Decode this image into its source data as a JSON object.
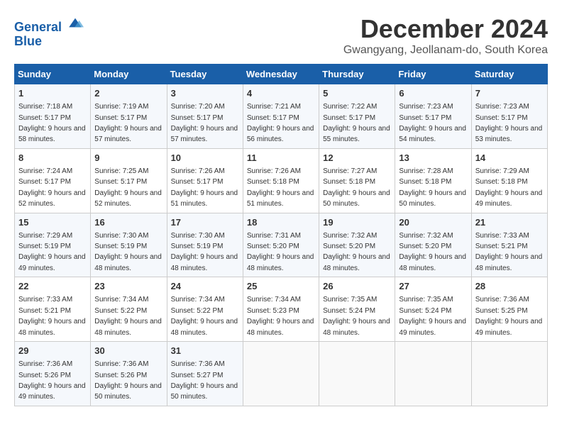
{
  "logo": {
    "line1": "General",
    "line2": "Blue",
    "arrow_color": "#1a5fa8"
  },
  "title": "December 2024",
  "location": "Gwangyang, Jeollanam-do, South Korea",
  "days_of_week": [
    "Sunday",
    "Monday",
    "Tuesday",
    "Wednesday",
    "Thursday",
    "Friday",
    "Saturday"
  ],
  "weeks": [
    [
      {
        "day": 1,
        "sunrise": "7:18 AM",
        "sunset": "5:17 PM",
        "daylight": "9 hours and 58 minutes."
      },
      {
        "day": 2,
        "sunrise": "7:19 AM",
        "sunset": "5:17 PM",
        "daylight": "9 hours and 57 minutes."
      },
      {
        "day": 3,
        "sunrise": "7:20 AM",
        "sunset": "5:17 PM",
        "daylight": "9 hours and 57 minutes."
      },
      {
        "day": 4,
        "sunrise": "7:21 AM",
        "sunset": "5:17 PM",
        "daylight": "9 hours and 56 minutes."
      },
      {
        "day": 5,
        "sunrise": "7:22 AM",
        "sunset": "5:17 PM",
        "daylight": "9 hours and 55 minutes."
      },
      {
        "day": 6,
        "sunrise": "7:23 AM",
        "sunset": "5:17 PM",
        "daylight": "9 hours and 54 minutes."
      },
      {
        "day": 7,
        "sunrise": "7:23 AM",
        "sunset": "5:17 PM",
        "daylight": "9 hours and 53 minutes."
      }
    ],
    [
      {
        "day": 8,
        "sunrise": "7:24 AM",
        "sunset": "5:17 PM",
        "daylight": "9 hours and 52 minutes."
      },
      {
        "day": 9,
        "sunrise": "7:25 AM",
        "sunset": "5:17 PM",
        "daylight": "9 hours and 52 minutes."
      },
      {
        "day": 10,
        "sunrise": "7:26 AM",
        "sunset": "5:17 PM",
        "daylight": "9 hours and 51 minutes."
      },
      {
        "day": 11,
        "sunrise": "7:26 AM",
        "sunset": "5:18 PM",
        "daylight": "9 hours and 51 minutes."
      },
      {
        "day": 12,
        "sunrise": "7:27 AM",
        "sunset": "5:18 PM",
        "daylight": "9 hours and 50 minutes."
      },
      {
        "day": 13,
        "sunrise": "7:28 AM",
        "sunset": "5:18 PM",
        "daylight": "9 hours and 50 minutes."
      },
      {
        "day": 14,
        "sunrise": "7:29 AM",
        "sunset": "5:18 PM",
        "daylight": "9 hours and 49 minutes."
      }
    ],
    [
      {
        "day": 15,
        "sunrise": "7:29 AM",
        "sunset": "5:19 PM",
        "daylight": "9 hours and 49 minutes."
      },
      {
        "day": 16,
        "sunrise": "7:30 AM",
        "sunset": "5:19 PM",
        "daylight": "9 hours and 48 minutes."
      },
      {
        "day": 17,
        "sunrise": "7:30 AM",
        "sunset": "5:19 PM",
        "daylight": "9 hours and 48 minutes."
      },
      {
        "day": 18,
        "sunrise": "7:31 AM",
        "sunset": "5:20 PM",
        "daylight": "9 hours and 48 minutes."
      },
      {
        "day": 19,
        "sunrise": "7:32 AM",
        "sunset": "5:20 PM",
        "daylight": "9 hours and 48 minutes."
      },
      {
        "day": 20,
        "sunrise": "7:32 AM",
        "sunset": "5:20 PM",
        "daylight": "9 hours and 48 minutes."
      },
      {
        "day": 21,
        "sunrise": "7:33 AM",
        "sunset": "5:21 PM",
        "daylight": "9 hours and 48 minutes."
      }
    ],
    [
      {
        "day": 22,
        "sunrise": "7:33 AM",
        "sunset": "5:21 PM",
        "daylight": "9 hours and 48 minutes."
      },
      {
        "day": 23,
        "sunrise": "7:34 AM",
        "sunset": "5:22 PM",
        "daylight": "9 hours and 48 minutes."
      },
      {
        "day": 24,
        "sunrise": "7:34 AM",
        "sunset": "5:22 PM",
        "daylight": "9 hours and 48 minutes."
      },
      {
        "day": 25,
        "sunrise": "7:34 AM",
        "sunset": "5:23 PM",
        "daylight": "9 hours and 48 minutes."
      },
      {
        "day": 26,
        "sunrise": "7:35 AM",
        "sunset": "5:24 PM",
        "daylight": "9 hours and 48 minutes."
      },
      {
        "day": 27,
        "sunrise": "7:35 AM",
        "sunset": "5:24 PM",
        "daylight": "9 hours and 49 minutes."
      },
      {
        "day": 28,
        "sunrise": "7:36 AM",
        "sunset": "5:25 PM",
        "daylight": "9 hours and 49 minutes."
      }
    ],
    [
      {
        "day": 29,
        "sunrise": "7:36 AM",
        "sunset": "5:26 PM",
        "daylight": "9 hours and 49 minutes."
      },
      {
        "day": 30,
        "sunrise": "7:36 AM",
        "sunset": "5:26 PM",
        "daylight": "9 hours and 50 minutes."
      },
      {
        "day": 31,
        "sunrise": "7:36 AM",
        "sunset": "5:27 PM",
        "daylight": "9 hours and 50 minutes."
      },
      null,
      null,
      null,
      null
    ]
  ]
}
